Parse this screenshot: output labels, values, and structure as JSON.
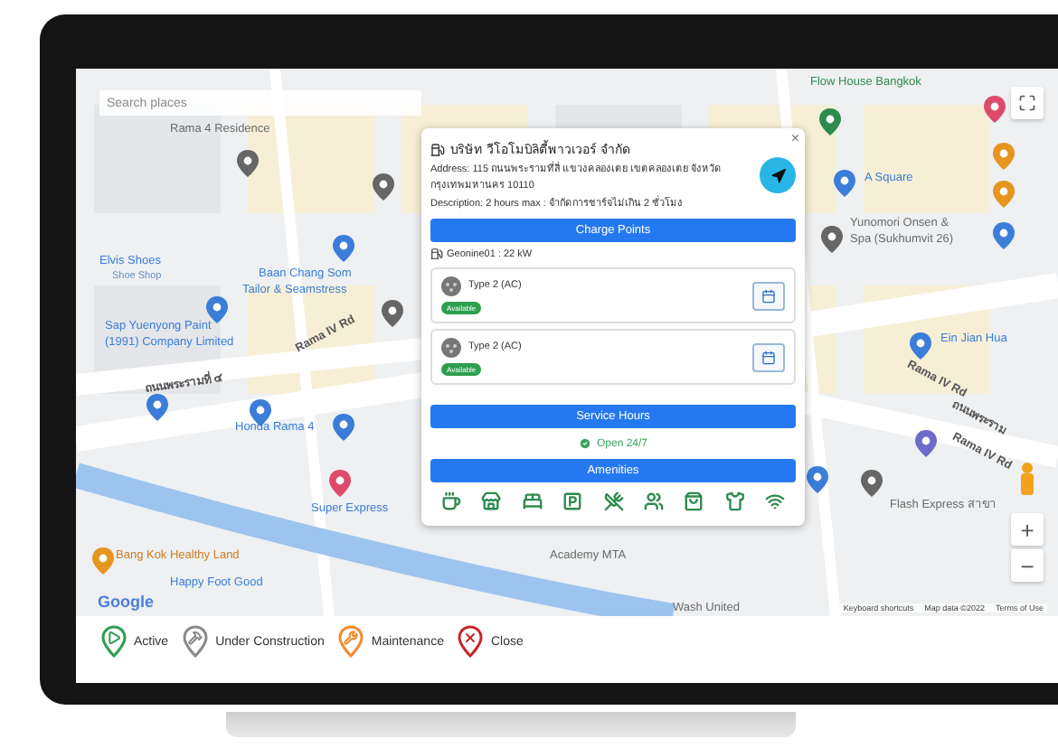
{
  "search": {
    "placeholder": "Search places"
  },
  "map_labels": [
    "Rama 4 Residence",
    "Elvis Shoes",
    "Shoe Shop",
    "Baan Chang Som",
    "Tailor & Seamstress",
    "Sap Yuenyong Paint",
    "(1991) Company Limited",
    "Rama IV Rd",
    "ถนนพระรามที่ ๔",
    "Honda Rama 4",
    "Super Express",
    "Bang Kok Healthy Land",
    "Happy Foot Good",
    "Flow House Bangkok",
    "A Square",
    "Yunomori Onsen &",
    "Spa (Sukhumvit 26)",
    "Ein Jian Hua",
    "Rama IV Rd",
    "ถนนพระราม",
    "Rama IV Rd",
    "Flash Express สาขา",
    "Academy MTA",
    "Wash United"
  ],
  "attribution": {
    "logo": "Google",
    "links": [
      "Keyboard shortcuts",
      "Map data ©2022",
      "Terms of Use"
    ]
  },
  "zoom": {
    "in": "+",
    "out": "−"
  },
  "popup": {
    "close": "×",
    "name": "บริษัท วีโอโมบิลิตี้พาวเวอร์ จำกัด",
    "address": "Address: 115 ถนนพระรามที่สี่ แขวงคลองเตย เขตคลองเตย จังหวัดกรุงเทพมหานคร 10110",
    "description": "Description: 2 hours max : จำกัดการชาร์จไม่เกิน 2 ชั่วโมง",
    "charge_title": "Charge Points",
    "charger": "Geonine01 : 22 kW",
    "connectors": [
      {
        "type": "Type 2 (AC)",
        "status": "Available",
        "color": "#2e9e4f"
      },
      {
        "type": "Type 2 (AC)",
        "status": "Available",
        "color": "#2e9e4f"
      }
    ],
    "hours_title": "Service Hours",
    "hours": "Open 24/7",
    "amenities_title": "Amenities"
  },
  "legend": [
    {
      "label": "Active",
      "color": "#2e9e4f",
      "kind": "active"
    },
    {
      "label": "Under Construction",
      "color": "#8a8a8a",
      "kind": "construction"
    },
    {
      "label": "Maintenance",
      "color": "#f08c2e",
      "kind": "maintenance"
    },
    {
      "label": "Close",
      "color": "#c62828",
      "kind": "close"
    }
  ]
}
